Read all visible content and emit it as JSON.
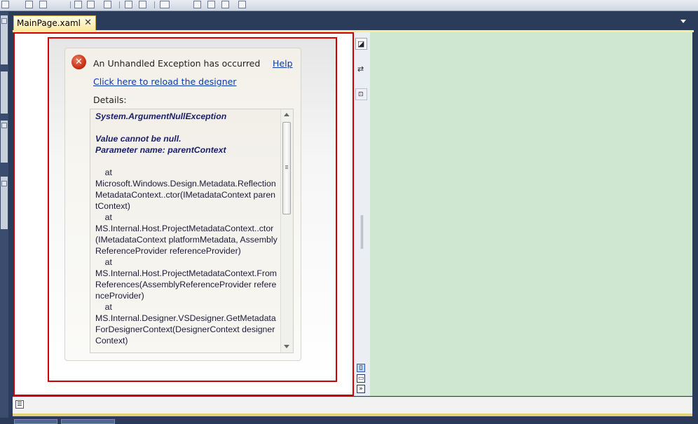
{
  "editor": {
    "tab_label": "MainPage.xaml",
    "tab_close": "✕"
  },
  "error": {
    "title": "An Unhandled Exception has occurred",
    "help_link": "Help",
    "reload_link": "Click here to reload the designer",
    "details_label": "Details:",
    "exception_type": "System.ArgumentNullException",
    "message_line1": "Value cannot be null.",
    "message_line2": "Parameter name: parentContext",
    "stack": [
      "    at",
      "Microsoft.Windows.Design.Metadata.ReflectionMetadataContext..ctor(IMetadataContext parentContext)",
      "    at",
      "MS.Internal.Host.ProjectMetadataContext..ctor(IMetadataContext platformMetadata, AssemblyReferenceProvider referenceProvider)",
      "    at",
      "MS.Internal.Host.ProjectMetadataContext.FromReferences(AssemblyReferenceProvider referenceProvider)",
      "    at",
      "MS.Internal.Designer.VSDesigner.GetMetadataForDesignerContext(DesignerContext designerContext)"
    ]
  },
  "colors": {
    "error_border": "#d00000",
    "link": "#0a3aa8",
    "xaml_pane": "#cfe6d1",
    "tab_active": "#ffe9a0"
  },
  "icons": {
    "error": "error-icon",
    "swap": "swap-panes-icon",
    "split": "split-icon"
  }
}
